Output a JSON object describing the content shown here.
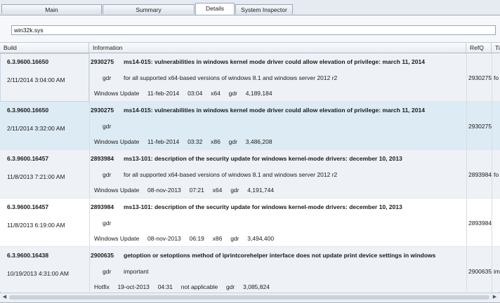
{
  "tabs": [
    {
      "label": "Main"
    },
    {
      "label": "Summary"
    },
    {
      "label": "Details"
    },
    {
      "label": "System Inspector"
    }
  ],
  "search": {
    "value": "win32k.sys"
  },
  "columns": {
    "build": "Build",
    "information": "Information",
    "refq": "RefQ",
    "truncated": "Ti"
  },
  "rows": [
    {
      "build": "6.3.9600.16650",
      "date": "2/11/2014 3:04:00 AM",
      "kb": "2930275",
      "title": "ms14-015: vulnerabilities in windows kernel mode driver could allow elevation of privilege: march 11, 2014",
      "branch": "gdr",
      "desc": "for all supported x64-based versions of windows 8.1 and windows server 2012 r2",
      "detail": "Windows Update     11-feb-2014     03:04     x64     gdr     4,189,184",
      "refq": "2930275",
      "trunc": "fo"
    },
    {
      "build": "6.3.9600.16650",
      "date": "2/11/2014 3:32:00 AM",
      "kb": "2930275",
      "title": "ms14-015: vulnerabilities in windows kernel mode driver could allow elevation of privilege: march 11, 2014",
      "branch": "gdr",
      "desc": "",
      "detail": "Windows Update     11-feb-2014     03:32     x86     gdr     3,486,208",
      "refq": "2930275",
      "trunc": ""
    },
    {
      "build": "6.3.9600.16457",
      "date": "11/8/2013 7:21:00 AM",
      "kb": "2893984",
      "title": "ms13-101: description of the security update for windows kernel-mode drivers: december 10, 2013",
      "branch": "gdr",
      "desc": "for all supported x64-based versions of windows 8.1 and windows server 2012 r2",
      "detail": "Windows Update     08-nov-2013     07:21     x64     gdr     4,191,744",
      "refq": "2893984",
      "trunc": "fo"
    },
    {
      "build": "6.3.9600.16457",
      "date": "11/8/2013 6:19:00 AM",
      "kb": "2893984",
      "title": "ms13-101: description of the security update for windows kernel-mode drivers: december 10, 2013",
      "branch": "gdr",
      "desc": "",
      "detail": "Windows Update     08-nov-2013     06:19     x86     gdr     3,494,400",
      "refq": "2893984",
      "trunc": ""
    },
    {
      "build": "6.3.9600.16438",
      "date": "10/19/2013 4:31:00 AM",
      "kb": "2900635",
      "title": "getoption or setoptions method of iprintcorehelper interface does not update print device settings in windows",
      "branch": "gdr",
      "desc": "important",
      "detail": "Hotfix     19-oct-2013     04:31     not applicable     gdr     3,085,824",
      "refq": "2900635",
      "trunc": "im"
    }
  ],
  "scrollbar": {
    "left_icon": "scroll-left-arrow-icon",
    "right_icon": "scroll-right-arrow-icon"
  }
}
